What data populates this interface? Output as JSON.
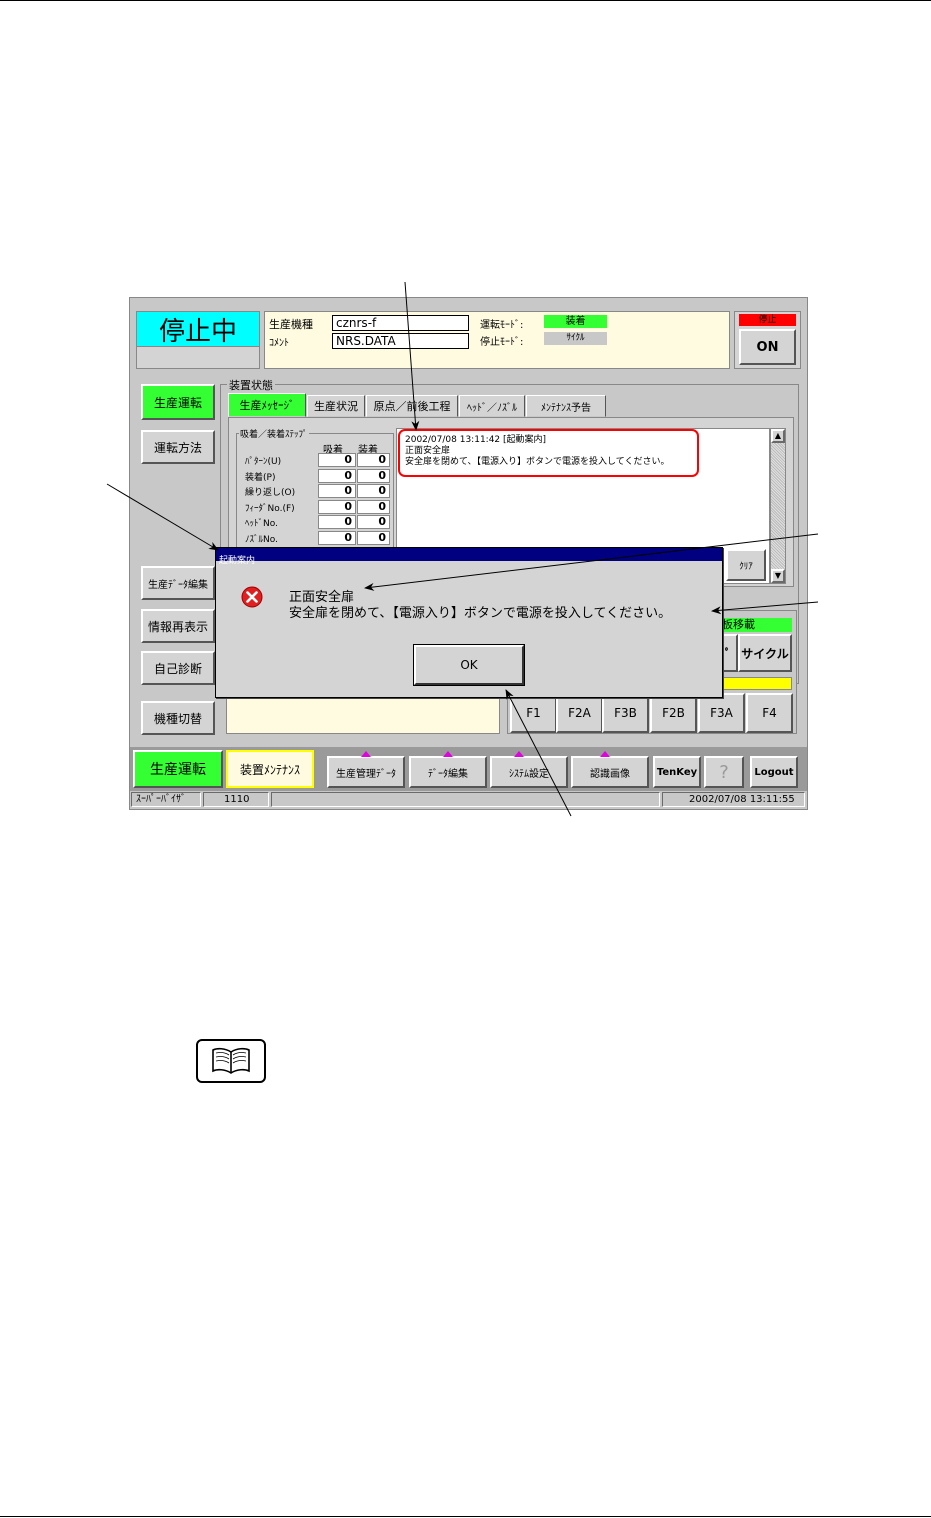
{
  "app": {
    "state_title": "停止中",
    "header": {
      "model_label": "生産機種",
      "model_value": "cznrs-f",
      "comment_label": "ｺﾒﾝﾄ",
      "comment_value": "NRS.DATA",
      "run_mode_label": "運転ﾓｰﾄﾞ:",
      "run_mode_value": "装着",
      "stop_mode_label": "停止ﾓｰﾄﾞ:",
      "stop_mode_value": "ｻｲｸﾙ",
      "stop_indicator": "停止",
      "on_button": "ON"
    },
    "left_buttons": {
      "production_run": "生産運転",
      "run_method": "運転方法",
      "prod_data_edit": "生産ﾃﾞｰﾀ編集",
      "info_redisplay": "情報再表示",
      "self_diagnosis": "自己診断",
      "model_switch": "機種切替"
    },
    "device_status": {
      "group_label": "装置状態",
      "tabs": [
        "生産ﾒｯｾｰｼﾞ",
        "生産状況",
        "原点／前後工程",
        "ﾍｯﾄﾞ／ﾉｽﾞﾙ",
        "ﾒﾝﾃﾅﾝｽ予告"
      ],
      "step_group_label": "吸着／装着ｽﾃｯﾌﾟ",
      "col_pick": "吸着",
      "col_place": "装着",
      "rows": [
        {
          "label": "ﾊﾟﾀｰﾝ(U)",
          "pick": "0",
          "place": "0"
        },
        {
          "label": "装着(P)",
          "pick": "0",
          "place": "0"
        },
        {
          "label": "繰り返し(O)",
          "pick": "0",
          "place": "0"
        },
        {
          "label": "ﾌｨｰﾀﾞNo.(F)",
          "pick": "0",
          "place": "0"
        },
        {
          "label": "ﾍｯﾄﾞNo.",
          "pick": "0",
          "place": "0"
        },
        {
          "label": "ﾉｽﾞﾙNo.",
          "pick": "0",
          "place": "0"
        }
      ],
      "message_line1": "2002/07/08 13:11:42 [起動案内]",
      "message_line2": "正面安全扉",
      "message_line3": "安全扉を閉めて、【電源入り】ボタンで電源を投入してください。",
      "clear_button": "ｸﾘｱ"
    },
    "right_panel": {
      "board_transfer_label": "板移載",
      "cycle_button": "サイクル",
      "partial_label": "ﾟ"
    },
    "function_keys": [
      "F1",
      "F2A",
      "F3B",
      "F2B",
      "F3A",
      "F4"
    ],
    "dialog": {
      "title": "起動案内",
      "line1": "正面安全扉",
      "line2": "安全扉を閉めて、【電源入り】ボタンで電源を投入してください。",
      "ok_button": "OK",
      "icon": "error-icon"
    },
    "taskbar": {
      "production_run": "生産運転",
      "device_maintenance": "装置ﾒﾝﾃﾅﾝｽ",
      "production_mgmt_data": "生産管理ﾃﾞｰﾀ",
      "data_edit": "ﾃﾞｰﾀ編集",
      "system_settings": "ｼｽﾃﾑ設定",
      "recognition_image": "認識画像",
      "tenkey": "TenKey",
      "help": "?",
      "logout": "Logout"
    },
    "statusbar": {
      "user": "ｽｰﾊﾟｰﾊﾞｲｻﾞ",
      "code": "1110",
      "middle": "",
      "datetime": "2002/07/08 13:11:55"
    }
  },
  "colors": {
    "cyan_title": "#00ffff",
    "green_active": "#33ff33",
    "yellow": "#ffff00",
    "red_indicator": "#ff0000",
    "cream": "#fffbe0",
    "dialog_titlebar": "#000080",
    "callout_red": "#ff0000",
    "tri_magenta": "#e000e0"
  },
  "icons": {
    "reference": "book-icon"
  }
}
